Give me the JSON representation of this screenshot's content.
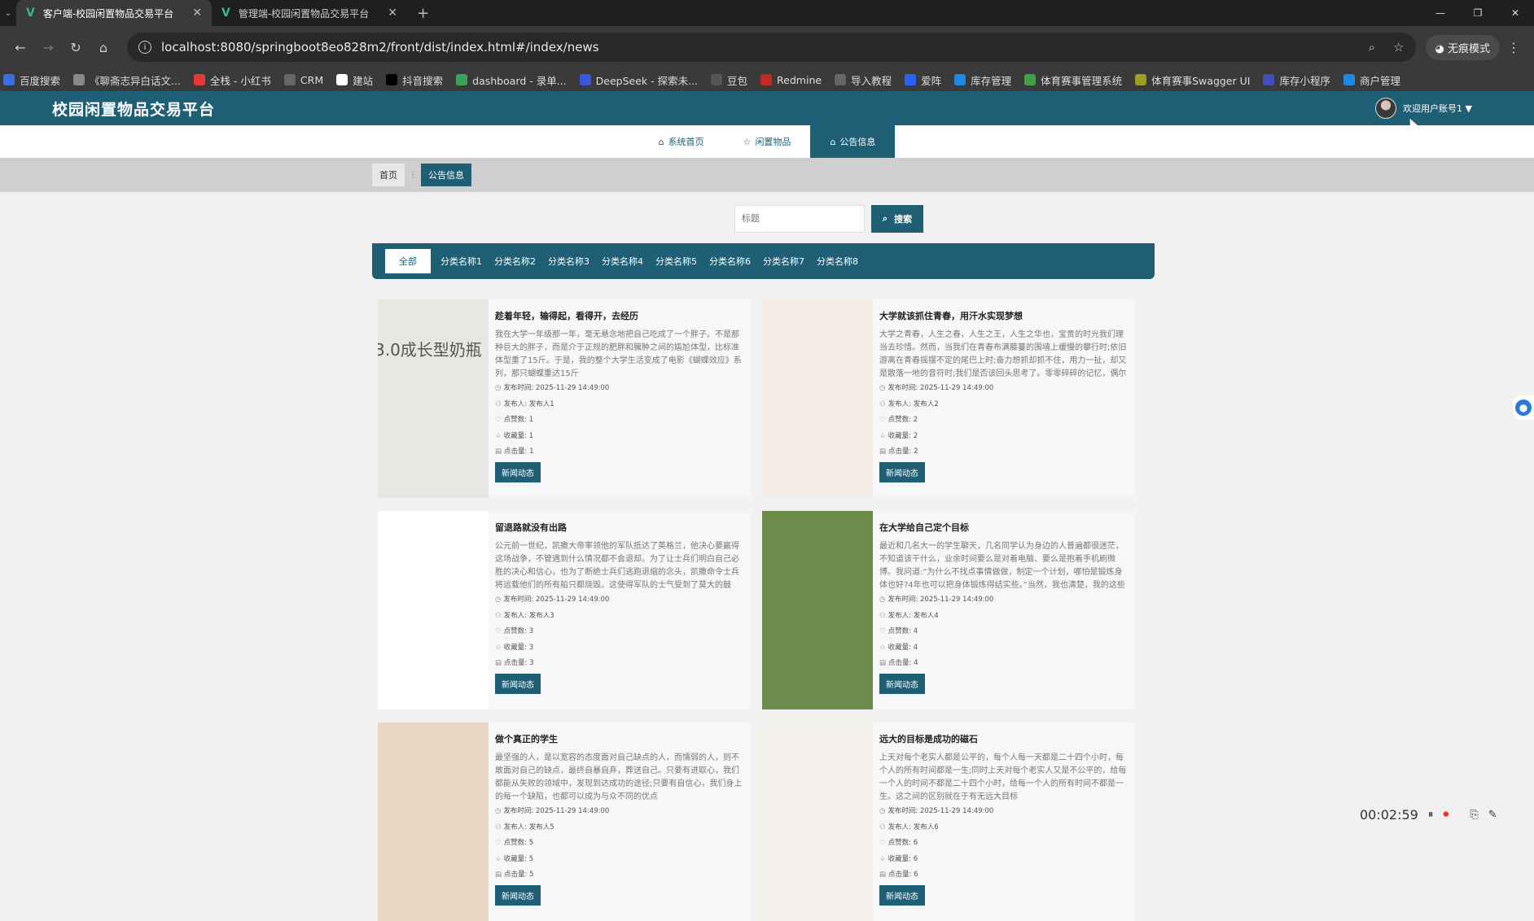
{
  "browser": {
    "tabs": [
      {
        "label": "客户端-校园闲置物品交易平台",
        "active": true
      },
      {
        "label": "管理端-校园闲置物品交易平台",
        "active": false
      }
    ],
    "url": "localhost:8080/springboot8eo828m2/front/dist/index.html#/index/news",
    "incognito_label": "无痕模式",
    "bookmarks": [
      "百度搜索",
      "《聊斋志异白话文...",
      "全栈 - 小红书",
      "CRM",
      "建站",
      "抖音搜索",
      "dashboard - 录单...",
      "DeepSeek - 探索未...",
      "豆包",
      "Redmine",
      "导入教程",
      "爱阵",
      "库存管理",
      "体育赛事管理系统",
      "体育赛事Swagger UI",
      "库存小程序",
      "商户管理"
    ]
  },
  "site": {
    "title": "校园闲置物品交易平台",
    "user_label": "欢迎用户账号1 ▼",
    "nav": [
      {
        "label": "系统首页",
        "icon": "home-icon",
        "glyph": "⌂"
      },
      {
        "label": "闲置物品",
        "icon": "star-icon",
        "glyph": "☆"
      },
      {
        "label": "公告信息",
        "icon": "bag-icon",
        "glyph": "⌂"
      }
    ],
    "breadcrumb": {
      "home": "首页",
      "current": "公告信息"
    },
    "search": {
      "placeholder": "标题",
      "button": "搜索"
    },
    "categories": [
      "全部",
      "分类名称1",
      "分类名称2",
      "分类名称3",
      "分类名称4",
      "分类名称5",
      "分类名称6",
      "分类名称7",
      "分类名称8"
    ]
  },
  "labels": {
    "time": "发布时间:",
    "author": "发布人:",
    "likes": "点赞数:",
    "favorites": "收藏量:",
    "clicks": "点击量:"
  },
  "news": [
    {
      "title": "趁着年轻，输得起，看得开，去经历",
      "desc": "我在大学一年级那一年，毫无悬念地把自己吃成了一个胖子。不是那种巨大的胖子，而是介于正规的肥胖和臃肿之间的尴尬体型，比标准体型重了15斤。于是，我的整个大学生活变成了电影《蝴蝶效应》系列，那只蝴蝶重达15斤",
      "time": "2025-11-29 14:49:00",
      "author": "发布人1",
      "likes": "1",
      "favorites": "1",
      "clicks": "1",
      "tag": "新闻动态",
      "thumb_text": "3.0成长型奶瓶",
      "thumb_color": "#e8e6e2"
    },
    {
      "title": "大学就该抓住青春，用汗水实现梦想",
      "desc": "大学之青春，人生之春，人生之王，人生之华也，宝贵的时光我们理当去珍惜。然而，当我们在青春布满藤蔓的围墙上缓慢的攀行时;依旧游离在青春摇摆不定的尾巴上时;奋力想抓却抓不住，用力一扯，却又是散落一地的音符时;我们是否该回头思考了。零零碎碎的记忆，偶尔会闪过寂寞的长空，飘然在无",
      "time": "2025-11-29 14:49:00",
      "author": "发布人2",
      "likes": "2",
      "favorites": "2",
      "clicks": "2",
      "tag": "新闻动态",
      "thumb_text": "",
      "thumb_color": "#f4ece6"
    },
    {
      "title": "留退路就没有出路",
      "desc": "公元前一世纪，凯撒大帝率领他的军队抵达了英格兰，他决心要赢得这场战争，不管遇到什么情况都不会退却。为了让士兵们明白自己必胜的决心和信心，也为了断绝士兵们逃跑退缩的念头，凯撒命令士兵将运载他们的所有船只都烧毁。这使得军队的士气受到了莫大的鼓舞。后来他们获胜了",
      "time": "2025-11-29 14:49:00",
      "author": "发布人3",
      "likes": "3",
      "favorites": "3",
      "clicks": "3",
      "tag": "新闻动态",
      "thumb_text": "",
      "thumb_color": "#ffffff"
    },
    {
      "title": "在大学给自己定个目标",
      "desc": "最近和几名大一的学生聊天，几名同学认为身边的人普遍都很迷茫，不知道该干什么，业余时间要么是对着电脑、要么是抱着手机刷微博。我问道:“为什么不找点事情做做，制定一个计划，哪怕是锻炼身体也好?4年也可以把身体锻炼得结实些。”当然，我也清楚，我的这些建议对他们来说，未必能有多大",
      "time": "2025-11-29 14:49:00",
      "author": "发布人4",
      "likes": "4",
      "favorites": "4",
      "clicks": "4",
      "tag": "新闻动态",
      "thumb_text": "",
      "thumb_color": "#6c8a4a"
    },
    {
      "title": "做个真正的学生",
      "desc": "最坚强的人，是以宽容的态度面对自己缺点的人，而懦弱的人，则不敢面对自己的缺点，最终自暴自弃，葬送自己。只要有进取心，我们都能从失败的领域中，发现到达成功的途径;只要有自信心，我们身上的每一个缺陷，也都可以成为与众不同的优点",
      "time": "2025-11-29 14:49:00",
      "author": "发布人5",
      "likes": "5",
      "favorites": "5",
      "clicks": "5",
      "tag": "新闻动态",
      "thumb_text": "",
      "thumb_color": "#e9d9c4"
    },
    {
      "title": "远大的目标是成功的磁石",
      "desc": "上天对每个老实人都是公平的，每个人每一天都是二十四个小时，每个人的所有时间都是一生;同时上天对每个老实人又是不公平的，给每一个人的时间不都是二十四个小时，给每一个人的所有时间不都是一生。这之间的区别就在于有无远大目标",
      "time": "2025-11-29 14:49:00",
      "author": "发布人6",
      "likes": "6",
      "favorites": "6",
      "clicks": "6",
      "tag": "新闻动态",
      "thumb_text": "",
      "thumb_color": "#f3f0ec"
    }
  ],
  "recorder": {
    "time": "00:02:59"
  }
}
